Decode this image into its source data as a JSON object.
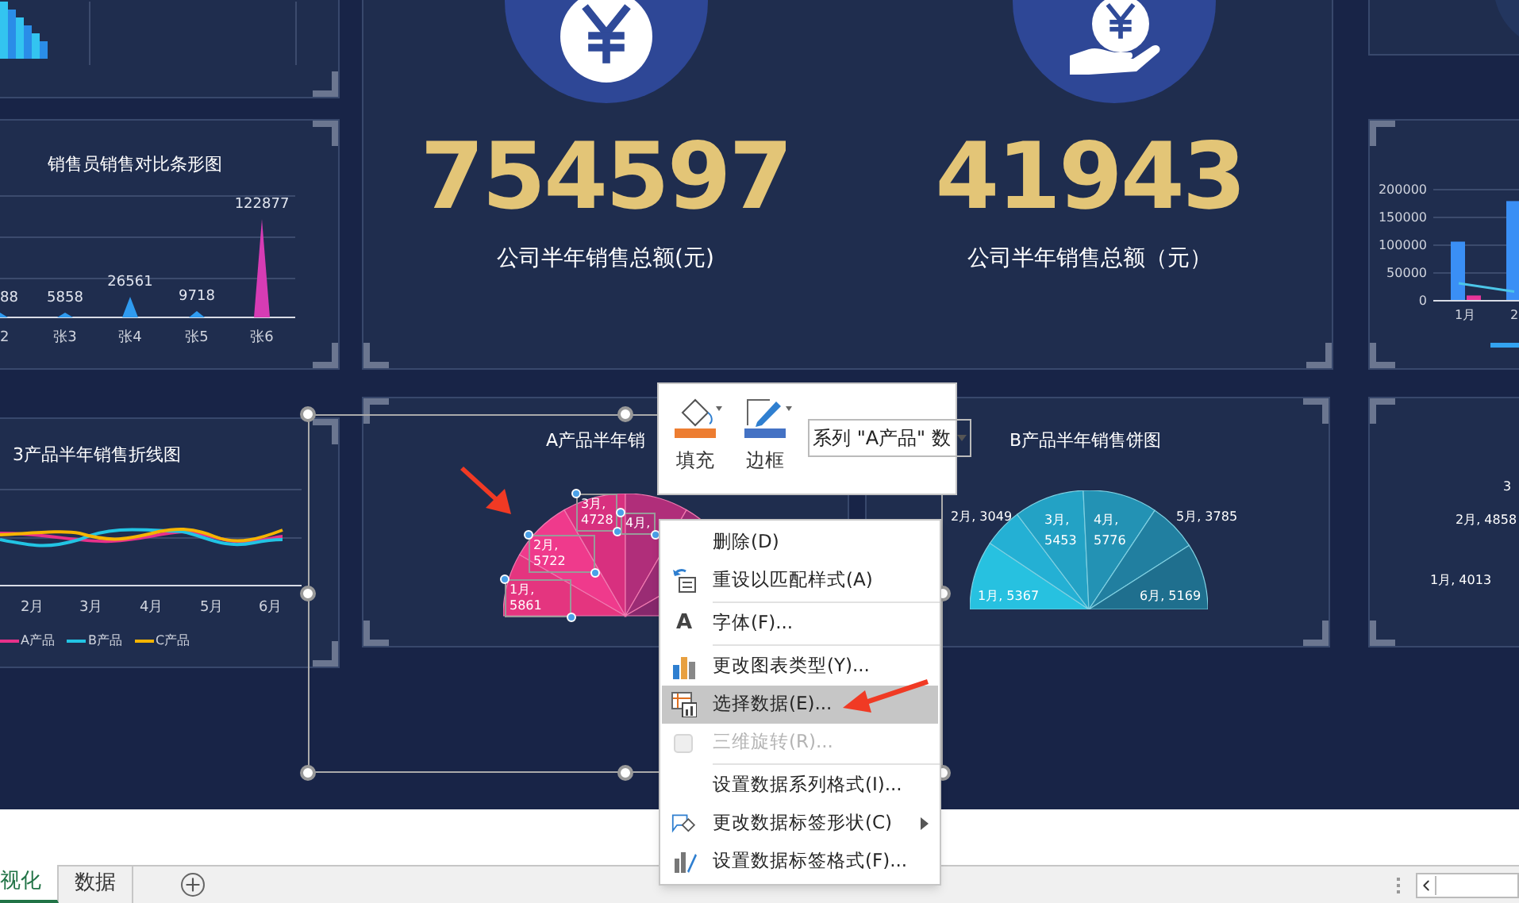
{
  "sales_chart": {
    "title": "销售员销售对比条形图",
    "value_labels": [
      "88",
      "5858",
      "26561",
      "9718",
      "122877"
    ],
    "x_labels": [
      "2",
      "张3",
      "张4",
      "张5",
      "张6"
    ]
  },
  "line_chart": {
    "title": "3产品半年销售折线图",
    "x_labels": [
      "2月",
      "3月",
      "4月",
      "5月",
      "6月"
    ],
    "legend": [
      {
        "label": "A产品",
        "color": "#e8318a"
      },
      {
        "label": "B产品",
        "color": "#22c4e4"
      },
      {
        "label": "C产品",
        "color": "#f5b400"
      }
    ]
  },
  "kpis": [
    {
      "value": "754597",
      "label": "公司半年销售总额(元)"
    },
    {
      "value": "41943",
      "label": "公司半年销售总额（元）"
    }
  ],
  "pie_a": {
    "title": "A产品半年销",
    "labels": [
      "1月, 5861",
      "2月, 5722",
      "3月, 4728",
      "4月,"
    ]
  },
  "pie_b": {
    "title": "B产品半年销售饼图",
    "chart_data": {
      "type": "pie",
      "values": [
        5367,
        3049,
        5453,
        5776,
        3785,
        5169
      ],
      "value_labels": [
        "1月, 5367",
        "2月, 3049",
        "3月, 5453",
        "4月, 5776",
        "5月, 3785",
        "6月, 5169"
      ]
    }
  },
  "right_bar": {
    "chart_data": {
      "type": "bar",
      "categories": [
        "1月",
        "2"
      ],
      "yticks": [
        0,
        50000,
        100000,
        150000,
        200000
      ],
      "ylim": [
        0,
        200000
      ],
      "grid": true,
      "series": [
        {
          "type": "bar",
          "color": "#3a8ff5",
          "values": [
            105000,
            178000
          ]
        },
        {
          "type": "bar",
          "color": "#e8359a",
          "values": [
            8000,
            null
          ]
        },
        {
          "type": "line",
          "color": "#4cc6e8",
          "values": [
            30000,
            15000
          ]
        }
      ]
    }
  },
  "right_pie": {
    "labels": [
      "3",
      "2月, 4858",
      "1月, 4013"
    ]
  },
  "mini_toolbar": {
    "buttons": [
      {
        "kind": "fill",
        "label": "填充"
      },
      {
        "kind": "border",
        "label": "边框"
      }
    ],
    "series_select": "系列 \"A产品\" 数"
  },
  "context_menu": [
    {
      "kind": "plain",
      "label": "删除(D)",
      "disabled": false,
      "selected": false,
      "submenu": false
    },
    {
      "kind": "reset",
      "label": "重设以匹配样式(A)",
      "disabled": false,
      "selected": false,
      "submenu": false
    },
    {
      "kind": "font",
      "icon_text": "A",
      "label": "字体(F)...",
      "disabled": false,
      "selected": false,
      "submenu": false
    },
    {
      "kind": "chart",
      "label": "更改图表类型(Y)...",
      "disabled": false,
      "selected": false,
      "submenu": false
    },
    {
      "kind": "data",
      "label": "选择数据(E)...",
      "disabled": false,
      "selected": true,
      "submenu": false
    },
    {
      "kind": "cube",
      "label": "三维旋转(R)...",
      "disabled": true,
      "selected": false,
      "submenu": false
    },
    {
      "kind": "plain",
      "label": "设置数据系列格式(I)...",
      "disabled": false,
      "selected": false,
      "submenu": false
    },
    {
      "kind": "shape",
      "label": "更改数据标签形状(C)",
      "disabled": false,
      "selected": false,
      "submenu": true
    },
    {
      "kind": "format",
      "label": "设置数据标签格式(F)...",
      "disabled": false,
      "selected": false,
      "submenu": false
    }
  ],
  "sheet_tabs": [
    {
      "label": "视化",
      "selected": true
    },
    {
      "label": "数据",
      "selected": false
    }
  ]
}
